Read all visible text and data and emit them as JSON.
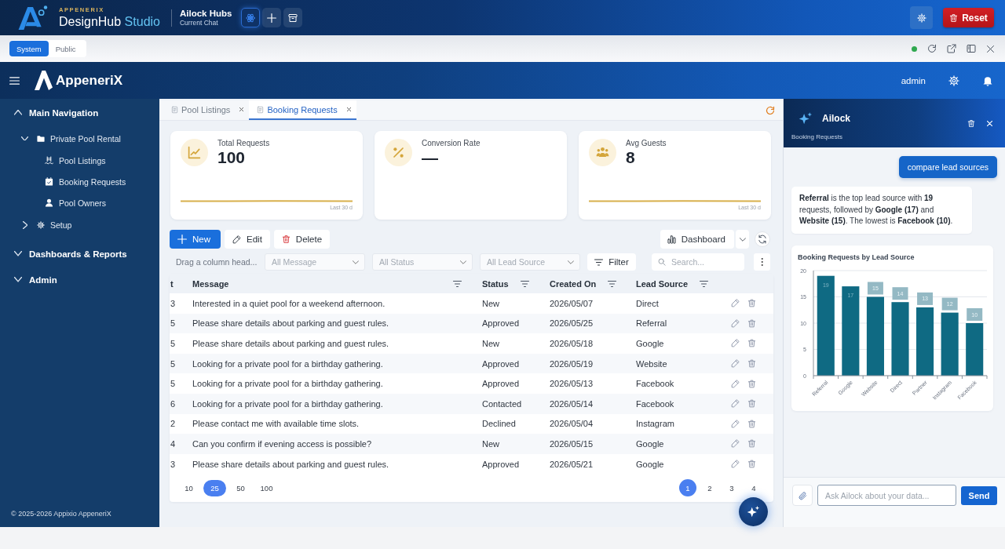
{
  "studio_bar": {
    "brand_caption": "APPENERIX",
    "brand_name": "DesignHub",
    "brand_accent": "Studio",
    "hub_title": "Ailock Hubs",
    "hub_subtitle": "Current Chat",
    "tool_buttons": [
      {
        "selected": true
      },
      {
        "selected": false
      },
      {
        "selected": false
      }
    ],
    "reset_button": "Reset"
  },
  "preview_bar": {
    "scopes": [
      {
        "label": "System",
        "selected": true
      },
      {
        "label": "Public",
        "selected": false
      }
    ],
    "connected": true
  },
  "app_header": {
    "logo_text": "AppeneriX",
    "user": "admin"
  },
  "sidebar": {
    "items": [
      {
        "label": "Main Navigation",
        "expanded": true,
        "children": [
          {
            "label": "Private Pool Rental",
            "expanded": true,
            "children": [
              {
                "label": "Pool Listings"
              },
              {
                "label": "Booking Requests"
              },
              {
                "label": "Pool Owners"
              }
            ]
          },
          {
            "label": "Setup",
            "expanded": false
          }
        ]
      },
      {
        "label": "Dashboards & Reports",
        "expanded": false
      },
      {
        "label": "Admin",
        "expanded": false
      }
    ],
    "footer": "© 2025-2026 Appixio AppeneriX"
  },
  "tabs": [
    {
      "label": "Pool Listings",
      "selected": false
    },
    {
      "label": "Booking Requests",
      "selected": true
    }
  ],
  "stat_cards": [
    {
      "label": "Total Requests",
      "value": "100",
      "sparkline": true,
      "caption": "Last 30 d"
    },
    {
      "label": "Conversion Rate",
      "value": "—",
      "sparkline": false
    },
    {
      "label": "Avg Guests",
      "value": "8",
      "sparkline": true,
      "caption": "Last 30 d"
    }
  ],
  "toolbar": {
    "new_button": "New",
    "edit_button": "Edit",
    "delete_button": "Delete",
    "dashboard_button": "Dashboard"
  },
  "filter_bar": {
    "group_hint": "Drag a column head...",
    "dropdowns": [
      {
        "placeholder": "All Message"
      },
      {
        "placeholder": "All Status"
      },
      {
        "placeholder": "All Lead Source"
      }
    ],
    "filter_button": "Filter",
    "search": {
      "placeholder": "Search..."
    }
  },
  "table": {
    "columns": [
      {
        "label": "t",
        "filterable": false
      },
      {
        "label": "Message",
        "filterable": true
      },
      {
        "label": "Status",
        "filterable": true
      },
      {
        "label": "Created On",
        "filterable": true
      },
      {
        "label": "Lead Source",
        "filterable": true
      }
    ],
    "rows": [
      [
        "3",
        "Interested in a quiet pool for a weekend afternoon.",
        "New",
        "2026/05/07",
        "Direct"
      ],
      [
        "5",
        "Please share details about parking and guest rules.",
        "Approved",
        "2026/05/25",
        "Referral"
      ],
      [
        "5",
        "Please share details about parking and guest rules.",
        "New",
        "2026/05/18",
        "Google"
      ],
      [
        "5",
        "Looking for a private pool for a birthday gathering.",
        "Approved",
        "2026/05/19",
        "Website"
      ],
      [
        "5",
        "Looking for a private pool for a birthday gathering.",
        "Approved",
        "2026/05/13",
        "Facebook"
      ],
      [
        "6",
        "Looking for a private pool for a birthday gathering.",
        "Contacted",
        "2026/05/14",
        "Facebook"
      ],
      [
        "2",
        "Please contact me with available time slots.",
        "Declined",
        "2026/05/04",
        "Instagram"
      ],
      [
        "4",
        "Can you confirm if evening access is possible?",
        "New",
        "2026/05/15",
        "Google"
      ],
      [
        "3",
        "Please share details about parking and guest rules.",
        "Approved",
        "2026/05/21",
        "Google"
      ]
    ]
  },
  "pagination": {
    "page_sizes": [
      {
        "label": "10",
        "selected": false
      },
      {
        "label": "25",
        "selected": true
      },
      {
        "label": "50",
        "selected": false
      },
      {
        "label": "100",
        "selected": false
      }
    ],
    "pages": [
      {
        "label": "1",
        "selected": true
      },
      {
        "label": "2",
        "selected": false
      },
      {
        "label": "3",
        "selected": false
      },
      {
        "label": "4",
        "selected": false
      }
    ]
  },
  "assistant": {
    "title": "Ailock",
    "subtitle": "Booking Requests",
    "messages": [
      {
        "kind": "question",
        "text": "compare lead sources"
      },
      {
        "kind": "answer",
        "text": "**Referral** is the top lead source with **19** requests, followed by **Google (17)** and **Website (15)**. The lowest is **Facebook (10)**."
      },
      {
        "kind": "chart",
        "chart_data": {
          "type": "bar",
          "title": "Booking Requests by Lead Source",
          "categories": [
            "Referral",
            "Google",
            "Website",
            "Direct",
            "Partner",
            "Instagram",
            "Facebook"
          ],
          "values": [
            19,
            17,
            15,
            14,
            13,
            12,
            10
          ],
          "ylim": [
            0,
            20
          ],
          "yticks": [
            0,
            5,
            10,
            15,
            20
          ],
          "grid": true,
          "data_labels": true
        }
      }
    ],
    "input": {
      "placeholder": "Ask Ailock about your data..."
    },
    "send_button": "Send"
  }
}
